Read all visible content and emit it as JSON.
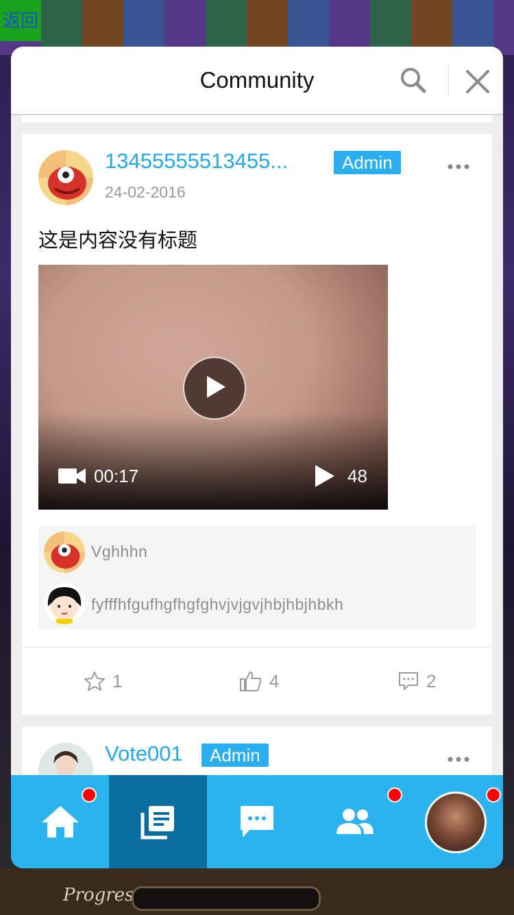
{
  "background": {
    "back_label": "返回",
    "progress_label": "Progress"
  },
  "header": {
    "title": "Community",
    "search_icon": "search-icon",
    "close_icon": "close-icon"
  },
  "post": {
    "username": "13455555513455...",
    "badge": "Admin",
    "date": "24-02-2016",
    "text": "这是内容没有标题",
    "video": {
      "duration": "00:17",
      "views": "48"
    },
    "comments": [
      {
        "text": "Vghhhn"
      },
      {
        "text": "fyfffhfgufhgfhgfghvjvjgvjhbjhbjhbkh"
      }
    ],
    "actions": {
      "favorites": "1",
      "likes": "4",
      "comments": "2"
    }
  },
  "next_post": {
    "username": "Vote001",
    "badge": "Admin"
  },
  "tabbar": {
    "tabs": [
      {
        "icon": "home-icon",
        "badge": true
      },
      {
        "icon": "posts-icon",
        "active": true
      },
      {
        "icon": "chat-icon"
      },
      {
        "icon": "friends-icon",
        "badge": true
      },
      {
        "icon": "profile-avatar",
        "badge": true
      }
    ]
  },
  "colors": {
    "accent": "#2bb3ef",
    "active_tab": "#0a6fa0",
    "username": "#27a7e8",
    "badge": "#2baef0",
    "notification": "#ff0000"
  }
}
